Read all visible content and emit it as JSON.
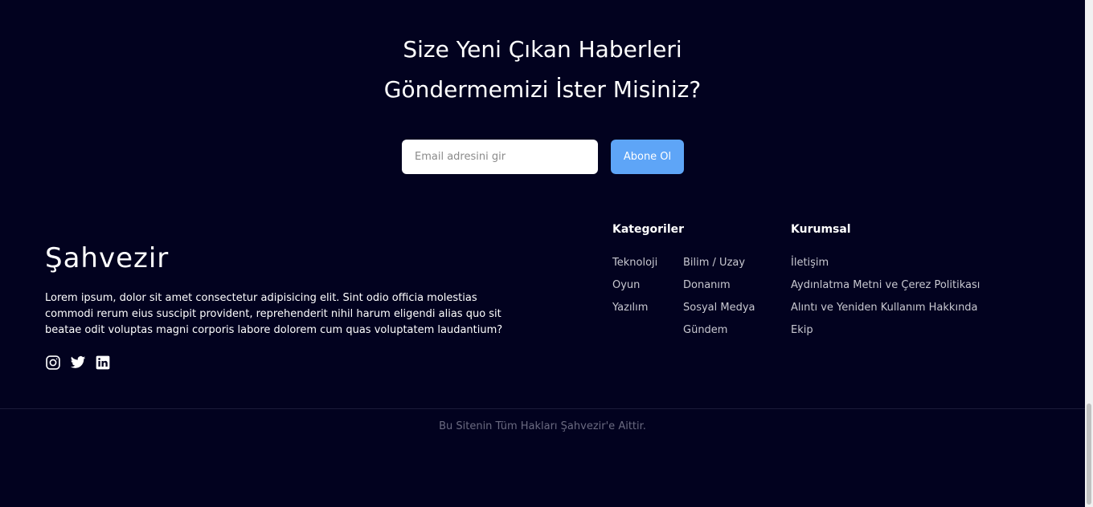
{
  "newsletter": {
    "title_line1": "Size Yeni Çıkan Haberleri",
    "title_line2": "Göndermemizi İster Misiniz?",
    "email_placeholder": "Email adresini gir",
    "email_value": "",
    "subscribe_label": "Abone Ol"
  },
  "brand": {
    "name": "Şahvezir",
    "description": "Lorem ipsum, dolor sit amet consectetur adipisicing elit. Sint odio officia molestias commodi rerum eius suscipit provident, reprehenderit nihil harum eligendi alias quo sit beatae odit voluptas magni corporis labore dolorem cum quas voluptatem laudantium?",
    "social": [
      {
        "icon": "instagram-icon"
      },
      {
        "icon": "twitter-icon"
      },
      {
        "icon": "linkedin-icon"
      }
    ]
  },
  "categories": {
    "heading": "Kategoriler",
    "col1": [
      "Teknoloji",
      "Oyun",
      "Yazılım"
    ],
    "col2": [
      "Bilim / Uzay",
      "Donanım",
      "Sosyal Medya",
      "Gündem"
    ]
  },
  "corporate": {
    "heading": "Kurumsal",
    "links": [
      "İletişim",
      "Aydınlatma Metni ve Çerez Politikası",
      "Alıntı ve Yeniden Kullanım Hakkında",
      "Ekip"
    ]
  },
  "footer": {
    "copyright": "Bu Sitenin Tüm Hakları Şahvezir'e Aittir."
  },
  "colors": {
    "background": "#02021f",
    "accent": "#5ea5f7",
    "link": "#c8c8d0",
    "muted": "#6a6a80"
  }
}
